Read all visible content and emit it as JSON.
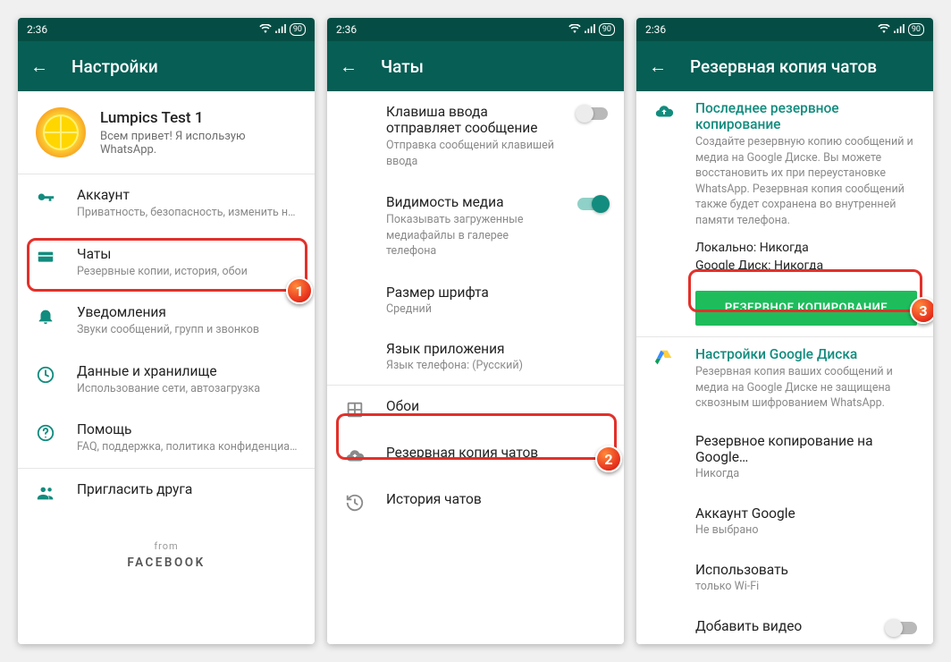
{
  "status": {
    "time": "2:36",
    "battery": "90"
  },
  "screen1": {
    "title": "Настройки",
    "profile": {
      "name": "Lumpics Test 1",
      "status": "Всем привет! Я использую WhatsApp."
    },
    "items": {
      "account": {
        "title": "Аккаунт",
        "sub": "Приватность, безопасность, изменить номер"
      },
      "chats": {
        "title": "Чаты",
        "sub": "Резервные копии, история, обои"
      },
      "notif": {
        "title": "Уведомления",
        "sub": "Звуки сообщений, групп и звонков"
      },
      "data": {
        "title": "Данные и хранилище",
        "sub": "Использование сети, автозагрузка"
      },
      "help": {
        "title": "Помощь",
        "sub": "FAQ, поддержка, политика конфиденциальн…"
      },
      "invite": {
        "title": "Пригласить друга"
      }
    },
    "from": "from",
    "brand": "FACEBOOK",
    "badge": "1"
  },
  "screen2": {
    "title": "Чаты",
    "enter": {
      "title": "Клавиша ввода отправляет сообщение",
      "sub": "Отправка сообщений клавишей ввода"
    },
    "media": {
      "title": "Видимость медиа",
      "sub": "Показывать загруженные медиафайлы в галерее телефона"
    },
    "font": {
      "title": "Размер шрифта",
      "sub": "Средний"
    },
    "lang": {
      "title": "Язык приложения",
      "sub": "Язык телефона: (Русский)"
    },
    "wall": {
      "title": "Обои"
    },
    "backup": {
      "title": "Резервная копия чатов"
    },
    "history": {
      "title": "История чатов"
    },
    "badge": "2"
  },
  "screen3": {
    "title": "Резервная копия чатов",
    "last": {
      "heading": "Последнее резервное копирование",
      "desc": "Создайте резервную копию сообщений и медиа на Google Диске. Вы можете восстановить их при переустановке WhatsApp. Резервная копия сообщений также будет сохранена во внутренней памяти телефона.",
      "local": "Локально: Никогда",
      "drive": "Google Диск: Никогда"
    },
    "button": "РЕЗЕРВНОЕ КОПИРОВАНИЕ",
    "gdrive": {
      "heading": "Настройки Google Диска",
      "desc": "Резервная копия ваших сообщений и медиа на Google Диске не защищена сквозным шифрованием WhatsApp."
    },
    "freq": {
      "title": "Резервное копирование на Google…",
      "sub": "Никогда"
    },
    "acct": {
      "title": "Аккаунт Google",
      "sub": "Не выбрано"
    },
    "net": {
      "title": "Использовать",
      "sub": "только Wi-Fi"
    },
    "video": {
      "title": "Добавить видео"
    },
    "badge": "3"
  }
}
